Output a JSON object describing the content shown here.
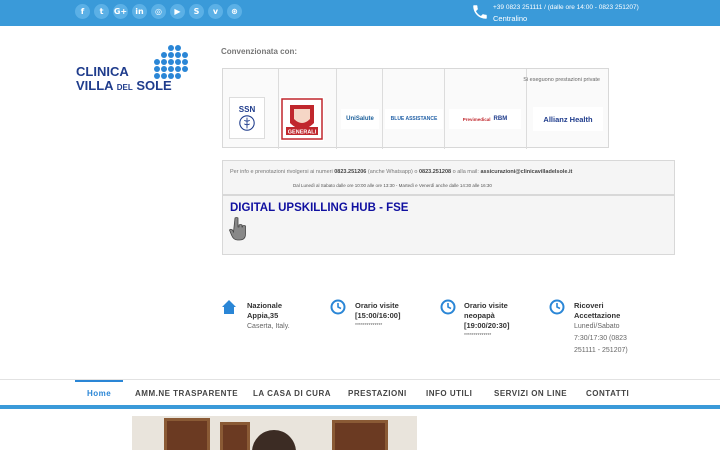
{
  "topbar": {
    "social": [
      {
        "icon": "facebook-icon",
        "glyph": "f"
      },
      {
        "icon": "twitter-icon",
        "glyph": "t"
      },
      {
        "icon": "google-plus-icon",
        "glyph": "G+"
      },
      {
        "icon": "linkedin-icon",
        "glyph": "in"
      },
      {
        "icon": "instagram-icon",
        "glyph": "◎"
      },
      {
        "icon": "youtube-icon",
        "glyph": "▶"
      },
      {
        "icon": "skype-icon",
        "glyph": "S"
      },
      {
        "icon": "vimeo-icon",
        "glyph": "v"
      },
      {
        "icon": "dribbble-icon",
        "glyph": "⊛"
      }
    ],
    "phone_line": "+39 0823 251111 / (dalle ore 14:00 - 0823 251207)",
    "phone_sub": "Centralino"
  },
  "logo": {
    "line1": "CLINICA",
    "line2a": "VILLA",
    "line2b": "DEL",
    "line2c": "SOLE"
  },
  "convenzionata": "Convenzionata con:",
  "partners": {
    "private_note": "Si eseguono prestazioni private",
    "logos": [
      "SSN",
      "GENERALI",
      "UniSalute",
      "BLUE ASSISTANCE",
      "Previmedical",
      "RBM",
      "Allianz Health"
    ]
  },
  "info": {
    "prefix": "Per info e prenotazioni rivolgersi ai numeri ",
    "num1": "0823.251206",
    "mid": " (anche Whatsapp) o ",
    "num2": "0823.251208",
    "mail_prefix": " o alla mail: ",
    "mail": "assicurazioni@clinicavilladelsole.it",
    "hours": "Dal Lunedì al Sabato dalle ore 10:00 alle ore 13:30 - Martedì e Venerdì anche dalle 14:30 alle 16:30"
  },
  "hub": {
    "title": "DIGITAL UPSKILLING HUB - FSE"
  },
  "contacts": [
    {
      "title_l1": "Nazionale",
      "title_l2": "Appia,35",
      "val_l1": "Caserta, Italy."
    },
    {
      "title_l1": "Orario visite",
      "title_l2": "[15:00/16:00]",
      "val_l1": "**************"
    },
    {
      "title_l1": "Orario visite",
      "title_l2": "neopapà",
      "title_l3": "[19:00/20:30]",
      "val_l1": "**************"
    },
    {
      "title_l1": "Ricoveri",
      "title_l2": "Accettazione",
      "val_l1": "Lunedì/Sabato",
      "val_l2": "7:30/17:30 (0823",
      "val_l3": "251111 - 251207)"
    }
  ],
  "nav": [
    "Home",
    "AMM.NE TRASPARENTE",
    "LA CASA DI CURA",
    "PRESTAZIONI",
    "INFO UTILI",
    "SERVIZI ON LINE",
    "CONTATTI"
  ],
  "colors": {
    "accent": "#3a9ad9",
    "brand": "#1f3c8c",
    "hub_title": "#1010a0"
  }
}
